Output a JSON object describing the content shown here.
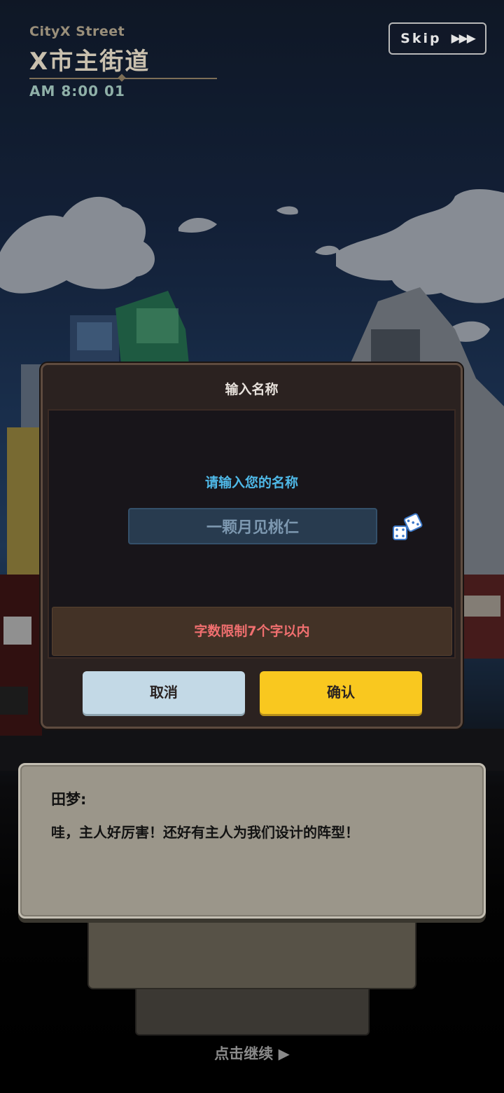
{
  "location": {
    "name_en": "CityX Street",
    "name_cn": "X市主街道",
    "time": "AM 8:00 01"
  },
  "skip": {
    "label": "Skip",
    "arrows": "▶▶▶"
  },
  "name_dialog": {
    "title": "输入名称",
    "prompt": "请输入您的名称",
    "name_value": "一颗月见桃仁",
    "limit_note": "字数限制7个字以内",
    "cancel_label": "取消",
    "confirm_label": "确认"
  },
  "dialogue": {
    "speaker": "田梦:",
    "line": "哇，主人好厉害！还好有主人为我们设计的阵型！"
  },
  "continue_hint": "点击继续 ▶",
  "colors": {
    "prompt": "#4fb9e8",
    "limit_text": "#f06f6f",
    "confirm_button": "#f9c81f",
    "cancel_button": "#c3d9e6"
  }
}
